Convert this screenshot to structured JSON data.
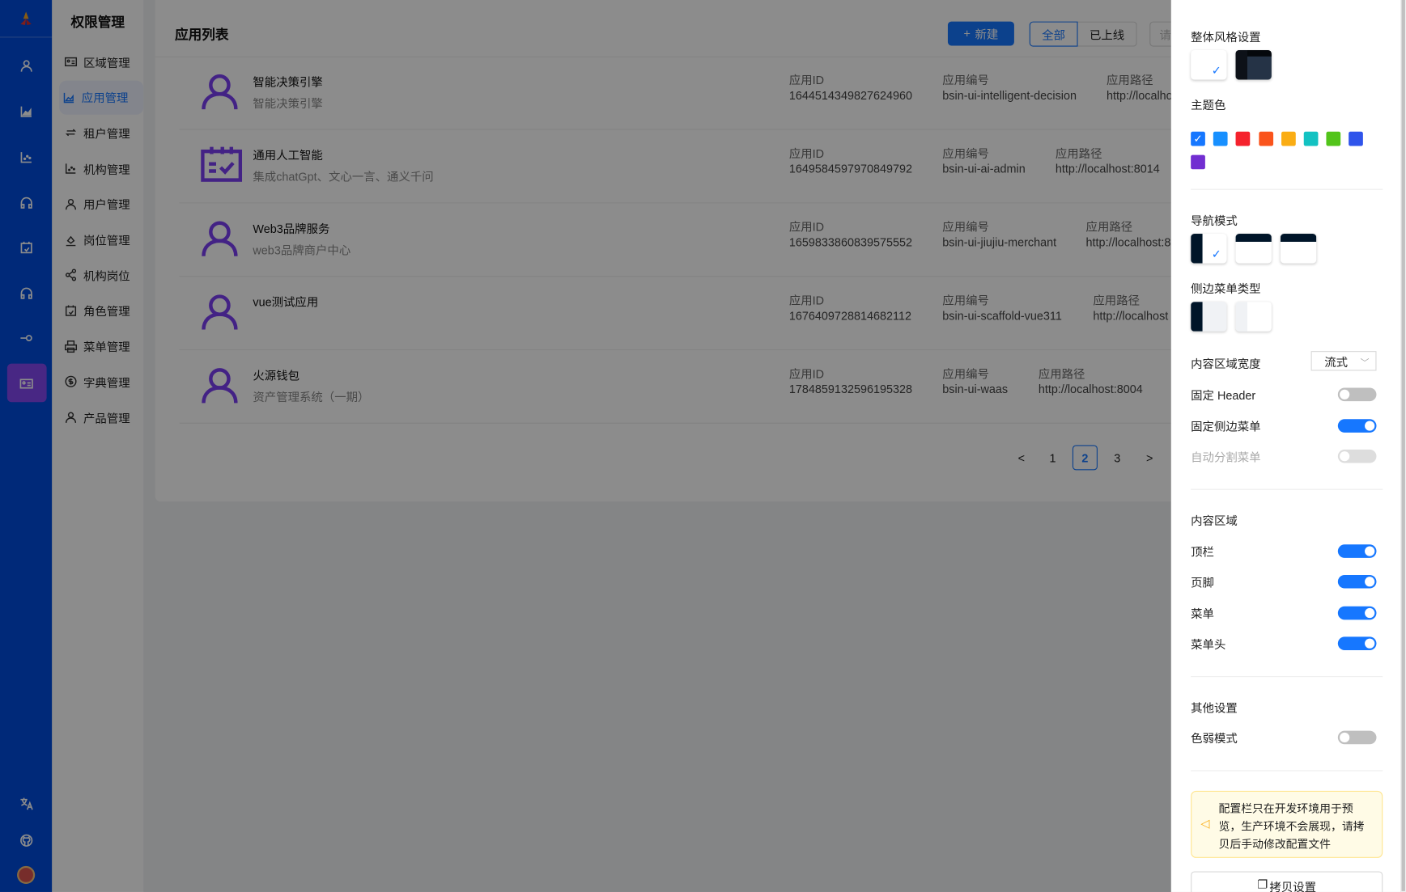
{
  "rail": {
    "icons": [
      "user-icon",
      "area-chart-icon",
      "dot-chart-icon",
      "headset-icon",
      "calendar-check-icon",
      "headset-icon",
      "key-icon",
      "idcard-icon"
    ],
    "bottom_icons": [
      "translate-icon",
      "github-icon",
      "avatar"
    ]
  },
  "submenu": {
    "title": "权限管理",
    "items": [
      {
        "label": "区域管理",
        "icon": "idcard-icon"
      },
      {
        "label": "应用管理",
        "icon": "area-chart-icon",
        "active": true
      },
      {
        "label": "租户管理",
        "icon": "swap-icon"
      },
      {
        "label": "机构管理",
        "icon": "dot-chart-icon"
      },
      {
        "label": "用户管理",
        "icon": "user-icon"
      },
      {
        "label": "岗位管理",
        "icon": "bg-colors-icon"
      },
      {
        "label": "机构岗位",
        "icon": "share-icon"
      },
      {
        "label": "角色管理",
        "icon": "calendar-check-icon"
      },
      {
        "label": "菜单管理",
        "icon": "printer-icon"
      },
      {
        "label": "字典管理",
        "icon": "dollar-icon"
      },
      {
        "label": "产品管理",
        "icon": "user-icon"
      }
    ]
  },
  "main": {
    "title": "应用列表",
    "new_label": "新建",
    "filters": [
      "全部",
      "已上线"
    ],
    "active_filter": "全部",
    "search_placeholder": "请",
    "labels": {
      "id": "应用ID",
      "code": "应用编号",
      "path": "应用路径"
    },
    "rows": [
      {
        "title": "智能决策引擎",
        "desc": "智能决策引擎",
        "id": "1644514349827624960",
        "code": "bsin-ui-intelligent-decision",
        "path": "http://localho",
        "icon": "user-icon"
      },
      {
        "title": "通用人工智能",
        "desc": "集成chatGpt、文心一言、通义千问",
        "id": "1649584597970849792",
        "code": "bsin-ui-ai-admin",
        "path": "http://localhost:8014",
        "icon": "calendar-check-icon"
      },
      {
        "title": "Web3品牌服务",
        "desc": "web3品牌商户中心",
        "id": "1659833860839575552",
        "code": "bsin-ui-jiujiu-merchant",
        "path": "http://localhost:8",
        "icon": "user-icon"
      },
      {
        "title": "vue测试应用",
        "desc": "",
        "id": "1676409728814682112",
        "code": "bsin-ui-scaffold-vue311",
        "path": "http://localhost",
        "icon": "user-icon"
      },
      {
        "title": "火源钱包",
        "desc": "资产管理系统（一期）",
        "id": "1784859132596195328",
        "code": "bsin-ui-waas",
        "path": "http://localhost:8004",
        "icon": "user-icon"
      }
    ],
    "pagination": {
      "pages": [
        "1",
        "2",
        "3"
      ],
      "current": "2",
      "prev": "<",
      "next": ">"
    }
  },
  "settings": {
    "style_title": "整体风格设置",
    "theme_title": "主题色",
    "theme_colors": [
      "#1677ff",
      "#1890ff",
      "#f5222d",
      "#fa541c",
      "#faad14",
      "#13c2c2",
      "#52c41a",
      "#2f54eb",
      "#722ed1"
    ],
    "nav_title": "导航模式",
    "side_title": "侧边菜单类型",
    "width_label": "内容区域宽度",
    "width_value": "流式",
    "toggles": [
      {
        "label": "固定 Header",
        "on": false
      },
      {
        "label": "固定侧边菜单",
        "on": true
      },
      {
        "label": "自动分割菜单",
        "on": false,
        "disabled": true
      }
    ],
    "content_title": "内容区域",
    "content_toggles": [
      {
        "label": "顶栏",
        "on": true
      },
      {
        "label": "页脚",
        "on": true
      },
      {
        "label": "菜单",
        "on": true
      },
      {
        "label": "菜单头",
        "on": true
      }
    ],
    "other_title": "其他设置",
    "other_toggles": [
      {
        "label": "色弱模式",
        "on": false
      }
    ],
    "notice": "配置栏只在开发环境用于预览，生产环境不会展现，请拷贝后手动修改配置文件",
    "copy_label": "拷贝设置"
  }
}
